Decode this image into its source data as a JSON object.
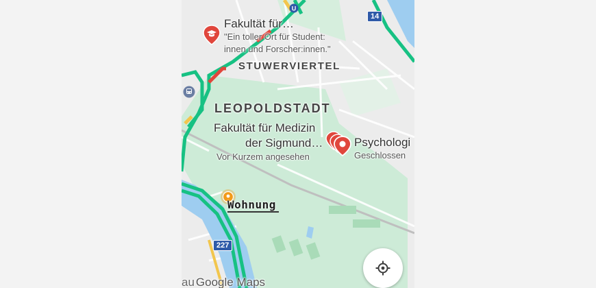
{
  "map": {
    "districts": [
      {
        "id": "stuwerviertel",
        "label": "STUWERVIERTEL"
      },
      {
        "id": "leopoldstadt",
        "label": "LEOPOLDSTADT"
      }
    ],
    "places": [
      {
        "id": "fakultaet-top",
        "title": "Fakultät für…",
        "subtitle_line1": "\"Ein toller Ort für Student:",
        "subtitle_line2": "innen und Forscher:innen.\"",
        "icon": "graduation-cap-icon"
      },
      {
        "id": "fakultaet-medizin",
        "title_line1": "Fakultät für Medizin",
        "title_line2": "der Sigmund…",
        "subtitle": "Vor Kurzem angesehen"
      },
      {
        "id": "psychologie",
        "title": "Psychologi",
        "subtitle": "Geschlossen",
        "icon": "red-pin-icon"
      }
    ],
    "saved_place": {
      "label": "Wohnung",
      "icon": "orange-pin-icon"
    },
    "road_shields": [
      "14",
      "227"
    ],
    "transit_icons": [
      "u-bahn-icon",
      "train-station-icon"
    ],
    "colors": {
      "park": "#cdebd7",
      "road_green": "#17c183",
      "road_yellow": "#f2c64d",
      "road_red": "#e0463c",
      "water": "#9ecdf0",
      "pin_red": "#e0463c",
      "pin_orange": "#f29a1a"
    }
  },
  "controls": {
    "locate_button_icon": "crosshair-icon"
  },
  "attribution": {
    "prefix": "au",
    "logo_text": "Google Maps"
  }
}
